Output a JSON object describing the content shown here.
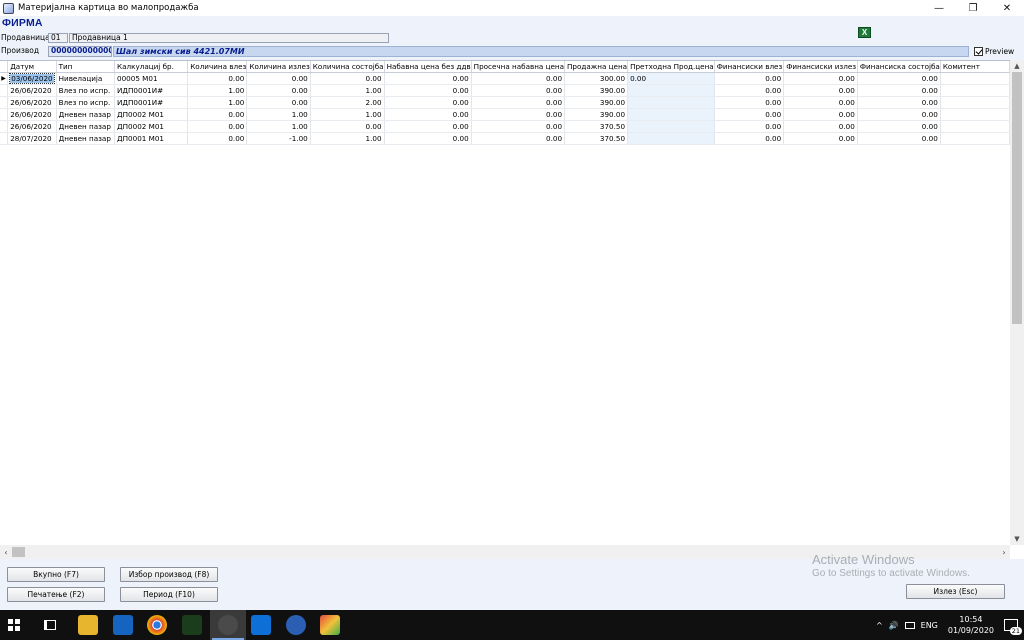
{
  "window": {
    "title": "Материјална картица во малопродажба",
    "buttons": [
      "—",
      "❐",
      "✕"
    ]
  },
  "header": {
    "firm": "ФИРМА",
    "store_label": "Продавница",
    "store_code": "01",
    "store_name": "Продавница 1",
    "product_label": "Производ",
    "product_code": "000000000000",
    "product_name": "Шал зимски сив 4421.07МИ",
    "preview_label": "Preview",
    "preview_checked": true
  },
  "table": {
    "columns": [
      "Датум",
      "Тип",
      "Калкулациј бр.",
      "Количина влез",
      "Количина излез",
      "Количина состојба",
      "Набавна цена без ддв",
      "Просечна набавна цена",
      "Продажна цена",
      "Претходна Прод.цена",
      "Финансиски влез",
      "Финансиски излез",
      "Финансиска состојба",
      "Комитент"
    ],
    "rows": [
      [
        "03/06/2020",
        "Нивелација",
        "00005  М01",
        "0.00",
        "0.00",
        "0.00",
        "0.00",
        "0.00",
        "300.00",
        "0.00",
        "0.00",
        "0.00",
        "0.00",
        ""
      ],
      [
        "26/06/2020",
        "Влез по испр.",
        "ИДП0001И#",
        "1.00",
        "0.00",
        "1.00",
        "0.00",
        "0.00",
        "390.00",
        "",
        "0.00",
        "0.00",
        "0.00",
        ""
      ],
      [
        "26/06/2020",
        "Влез по испр.",
        "ИДП0001И#",
        "1.00",
        "0.00",
        "2.00",
        "0.00",
        "0.00",
        "390.00",
        "",
        "0.00",
        "0.00",
        "0.00",
        ""
      ],
      [
        "26/06/2020",
        "Дневен пазар",
        "ДП0002 М01",
        "0.00",
        "1.00",
        "1.00",
        "0.00",
        "0.00",
        "390.00",
        "",
        "0.00",
        "0.00",
        "0.00",
        ""
      ],
      [
        "26/06/2020",
        "Дневен пазар",
        "ДП0002 М01",
        "0.00",
        "1.00",
        "0.00",
        "0.00",
        "0.00",
        "370.50",
        "",
        "0.00",
        "0.00",
        "0.00",
        ""
      ],
      [
        "28/07/2020",
        "Дневен пазар",
        "ДП0001 М01",
        "0.00",
        "-1.00",
        "1.00",
        "0.00",
        "0.00",
        "370.50",
        "",
        "0.00",
        "0.00",
        "0.00",
        ""
      ]
    ]
  },
  "buttons": {
    "total": "Вкупно (F7)",
    "select_product": "Избор производ (F8)",
    "print": "Печатење (F2)",
    "period": "Период (F10)",
    "exit": "Излез (Esc)"
  },
  "watermark": {
    "line1": "Activate Windows",
    "line2": "Go to Settings to activate Windows."
  },
  "taskbar": {
    "lang": "ENG",
    "time": "10:54",
    "date": "01/09/2020",
    "notifications": "21"
  }
}
